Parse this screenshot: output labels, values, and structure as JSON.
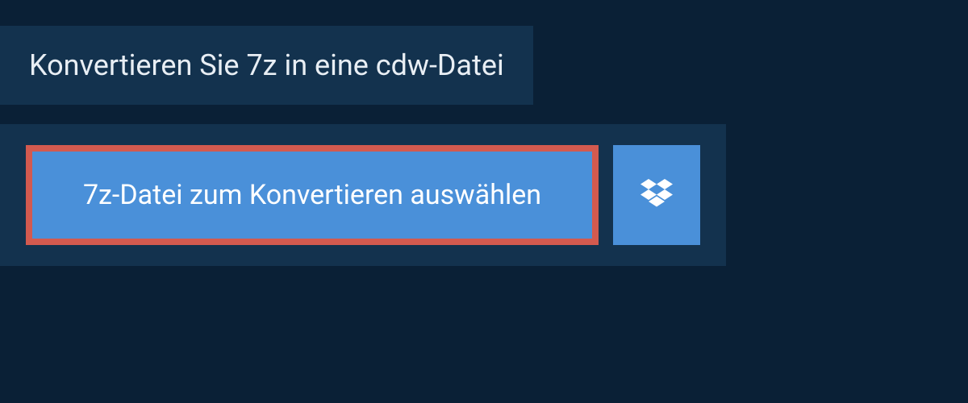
{
  "header": {
    "title": "Konvertieren Sie 7z in eine cdw-Datei"
  },
  "actions": {
    "select_file_label": "7z-Datei zum Konvertieren auswählen",
    "dropbox_icon": "dropbox-icon"
  },
  "colors": {
    "background": "#0a2036",
    "panel": "#13324e",
    "button": "#4a90d9",
    "highlight_border": "#d35a4f",
    "text": "#ffffff"
  }
}
